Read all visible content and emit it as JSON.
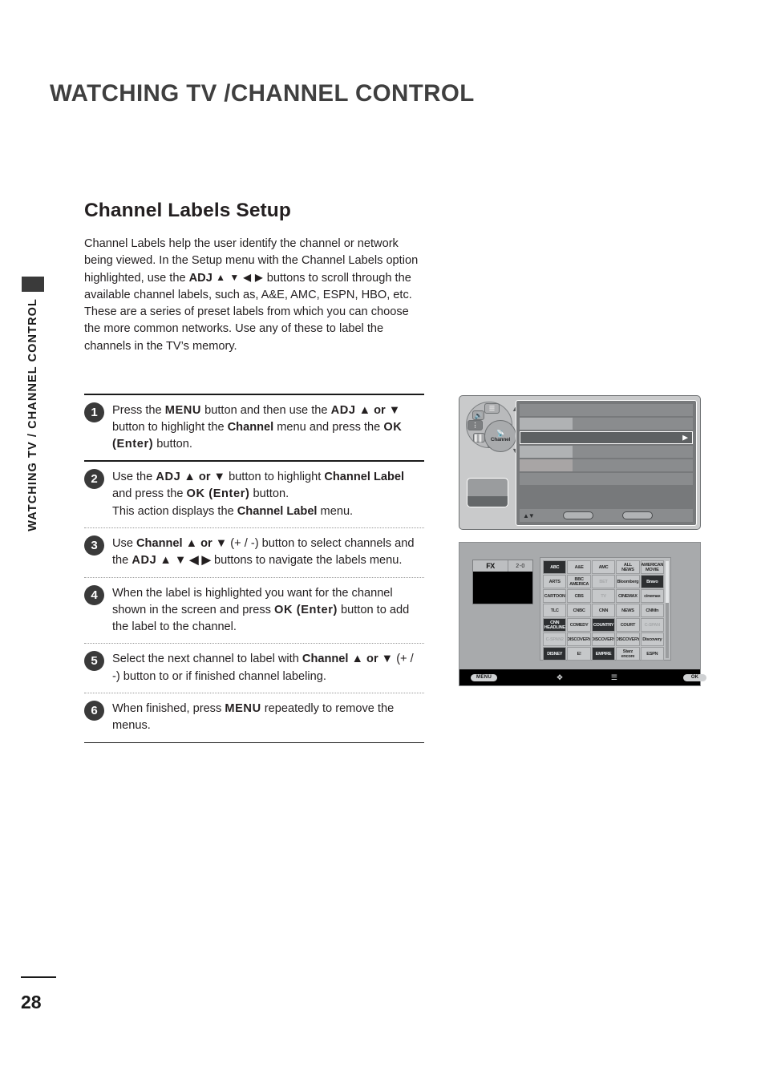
{
  "running_head": "WATCHING TV /CHANNEL CONTROL",
  "side_tab": {
    "label": "WATCHING TV / CHANNEL CONTROL"
  },
  "folio": {
    "page_number": "28"
  },
  "section": {
    "title": "Channel Labels Setup",
    "intro_lines": [
      "Channel Labels help the user identify the channel or network",
      "being viewed.",
      "In the Setup menu with the Channel Labels option highlighted,",
      "use the ",
      "ADJ",
      " ▲ ▼ ◀ ▶ ",
      "buttons to scroll through the",
      "available channel labels, such as, A&E, AMC, ESPN, HBO, etc.",
      "These are a series of preset labels from which you can choose",
      "the more common networks. Use any of these to label the",
      "channels in the TV’s memory."
    ]
  },
  "steps": [
    {
      "number": "1",
      "segments": [
        {
          "t": "Press the ",
          "s": "n"
        },
        {
          "t": "MENU",
          "s": "bw"
        },
        {
          "t": " button and then use the ",
          "s": "n"
        },
        {
          "t": "ADJ",
          "s": "bw"
        },
        {
          "t": " ▲ or ▼",
          "s": "b"
        },
        {
          "t": " button to highlight the ",
          "s": "n"
        },
        {
          "t": "Channel",
          "s": "b"
        },
        {
          "t": " menu and press the ",
          "s": "n"
        },
        {
          "t": "OK (Enter)",
          "s": "bw"
        },
        {
          "t": " button.",
          "s": "n"
        }
      ]
    },
    {
      "number": "2",
      "segments": [
        {
          "t": "Use the ",
          "s": "n"
        },
        {
          "t": "ADJ",
          "s": "bw"
        },
        {
          "t": " ▲ or ▼",
          "s": "b"
        },
        {
          "t": " button to highlight ",
          "s": "n"
        },
        {
          "t": "Channel Label",
          "s": "b"
        },
        {
          "t": " and press the ",
          "s": "n"
        },
        {
          "t": "OK (Enter)",
          "s": "bw"
        },
        {
          "t": " button.",
          "s": "n"
        },
        {
          "t": "|",
          "s": "br"
        },
        {
          "t": "This action displays the ",
          "s": "n"
        },
        {
          "t": "Channel Label",
          "s": "b"
        },
        {
          "t": " menu.",
          "s": "n"
        }
      ]
    },
    {
      "number": "3",
      "segments": [
        {
          "t": "Use ",
          "s": "n"
        },
        {
          "t": "Channel",
          "s": "b"
        },
        {
          "t": " ▲ or ▼",
          "s": "b"
        },
        {
          "t": " (+ / -) button to select channels and the ",
          "s": "n"
        },
        {
          "t": "ADJ",
          "s": "bw"
        },
        {
          "t": " ▲ ▼ ◀ ▶",
          "s": "b"
        },
        {
          "t": " buttons to navigate the labels menu.",
          "s": "n"
        }
      ]
    },
    {
      "number": "4",
      "segments": [
        {
          "t": "When the label is highlighted you want for the channel shown in the screen and press ",
          "s": "n"
        },
        {
          "t": "OK (Enter)",
          "s": "bw"
        },
        {
          "t": " button to add the label to the channel.",
          "s": "n"
        }
      ]
    },
    {
      "number": "5",
      "segments": [
        {
          "t": "Select the next channel to label with ",
          "s": "n"
        },
        {
          "t": "Channel",
          "s": "b"
        },
        {
          "t": " ▲ or ▼",
          "s": "b"
        },
        {
          "t": " (+ / -) button to or if finished channel labeling.",
          "s": "n"
        }
      ]
    },
    {
      "number": "6",
      "segments": [
        {
          "t": "When finished, press ",
          "s": "n"
        },
        {
          "t": "MENU",
          "s": "bw"
        },
        {
          "t": " repeatedly to remove the menus.",
          "s": "n"
        }
      ]
    }
  ],
  "figure_menu": {
    "wheel": {
      "center_label": "Channel",
      "segment_ab": "AB",
      "up_arrow": "▲",
      "down_arrow": "▼"
    },
    "osd_rows": [
      {
        "style": "plain"
      },
      {
        "style": "split"
      },
      {
        "style": "selected",
        "caret": "▶"
      },
      {
        "style": "split"
      },
      {
        "style": "split-alt"
      },
      {
        "style": "plain"
      }
    ],
    "footer": {
      "updown": "▲▼"
    }
  },
  "figure_grid": {
    "preview": {
      "logo": "FX",
      "channel": "2-0"
    },
    "logos": [
      {
        "text": "ABC",
        "style": "dark"
      },
      {
        "text": "A&E",
        "style": "normal"
      },
      {
        "text": "AMC",
        "style": "normal"
      },
      {
        "text": "ALL NEWS",
        "style": "normal"
      },
      {
        "text": "AMERICAN MOVIE",
        "style": "normal"
      },
      {
        "text": "ARTS",
        "style": "normal"
      },
      {
        "text": "BBC AMERICA",
        "style": "normal"
      },
      {
        "text": "BET",
        "style": "dim"
      },
      {
        "text": "Bloomberg",
        "style": "normal"
      },
      {
        "text": "Bravo",
        "style": "dark"
      },
      {
        "text": "CARTOON",
        "style": "normal"
      },
      {
        "text": "CBS",
        "style": "normal"
      },
      {
        "text": "TV",
        "style": "dim"
      },
      {
        "text": "CINEMAX",
        "style": "normal"
      },
      {
        "text": "cinemax",
        "style": "normal"
      },
      {
        "text": "TLC",
        "style": "normal"
      },
      {
        "text": "CNBC",
        "style": "normal"
      },
      {
        "text": "CNN",
        "style": "normal"
      },
      {
        "text": "NEWS",
        "style": "normal"
      },
      {
        "text": "CNNfn",
        "style": "normal"
      },
      {
        "text": "CNN HEADLINE",
        "style": "dark"
      },
      {
        "text": "COMEDY",
        "style": "normal"
      },
      {
        "text": "COUNTRY",
        "style": "dark"
      },
      {
        "text": "COURT",
        "style": "normal"
      },
      {
        "text": "C-SPAN",
        "style": "dim"
      },
      {
        "text": "C-SPAN2",
        "style": "dim"
      },
      {
        "text": "DISCOVERY",
        "style": "normal"
      },
      {
        "text": "DISCOVERY",
        "style": "normal"
      },
      {
        "text": "DISCOVERY",
        "style": "normal"
      },
      {
        "text": "Discovery",
        "style": "normal"
      },
      {
        "text": "DISNEY",
        "style": "dark"
      },
      {
        "text": "E!",
        "style": "normal"
      },
      {
        "text": "EMPIRE",
        "style": "dark"
      },
      {
        "text": "Starz encore",
        "style": "normal"
      },
      {
        "text": "ESPN",
        "style": "normal"
      }
    ],
    "footer": {
      "menu_key": "MENU",
      "dpad_icon": "✥",
      "remote_icon": "☰",
      "ok_key": "OK"
    }
  }
}
